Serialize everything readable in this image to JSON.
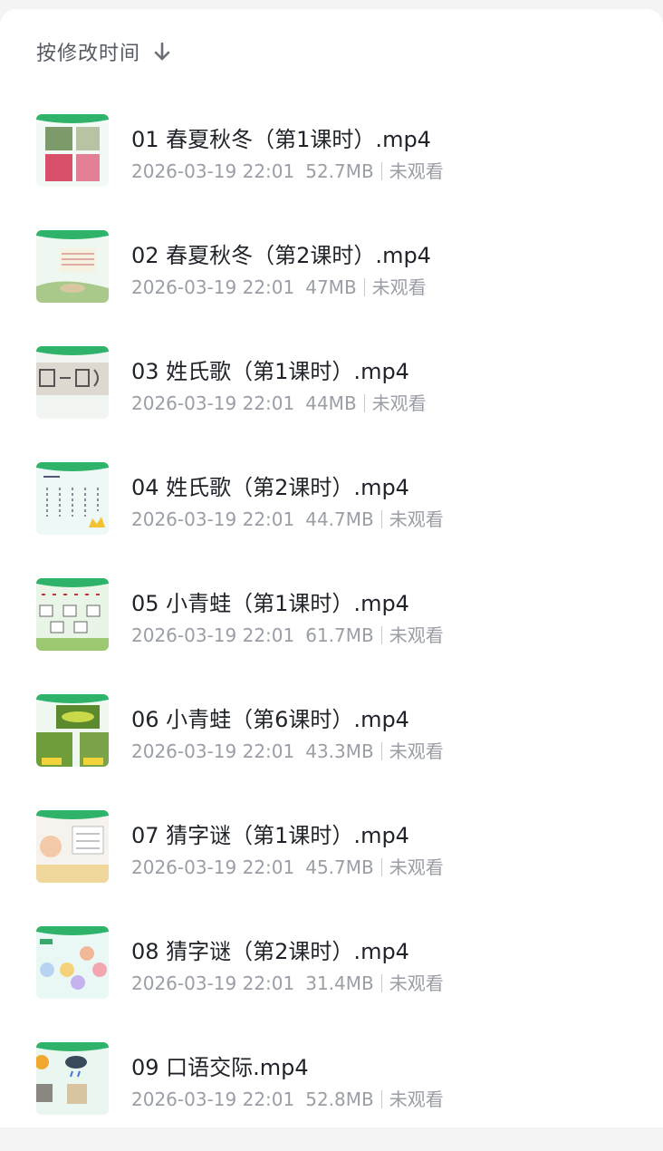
{
  "sort": {
    "label": "按修改时间",
    "direction_icon": "arrow-down-icon"
  },
  "files": [
    {
      "name": "01 春夏秋冬（第1课时）.mp4",
      "date": "2026-03-19 22:01",
      "size": "52.7MB",
      "status": "未观看"
    },
    {
      "name": "02 春夏秋冬（第2课时）.mp4",
      "date": "2026-03-19 22:01",
      "size": "47MB",
      "status": "未观看"
    },
    {
      "name": "03 姓氏歌（第1课时）.mp4",
      "date": "2026-03-19 22:01",
      "size": "44MB",
      "status": "未观看"
    },
    {
      "name": "04 姓氏歌（第2课时）.mp4",
      "date": "2026-03-19 22:01",
      "size": "44.7MB",
      "status": "未观看"
    },
    {
      "name": "05 小青蛙（第1课时）.mp4",
      "date": "2026-03-19 22:01",
      "size": "61.7MB",
      "status": "未观看"
    },
    {
      "name": "06 小青蛙（第6课时）.mp4",
      "date": "2026-03-19 22:01",
      "size": "43.3MB",
      "status": "未观看"
    },
    {
      "name": "07 猜字谜（第1课时）.mp4",
      "date": "2026-03-19 22:01",
      "size": "45.7MB",
      "status": "未观看"
    },
    {
      "name": "08 猜字谜（第2课时）.mp4",
      "date": "2026-03-19 22:01",
      "size": "31.4MB",
      "status": "未观看"
    },
    {
      "name": "09 口语交际.mp4",
      "date": "2026-03-19 22:01",
      "size": "52.8MB",
      "status": "未观看"
    }
  ],
  "colors": {
    "accent_green": "#2fb36b",
    "title_text": "#1f2329",
    "meta_text": "#9a9ea6"
  }
}
